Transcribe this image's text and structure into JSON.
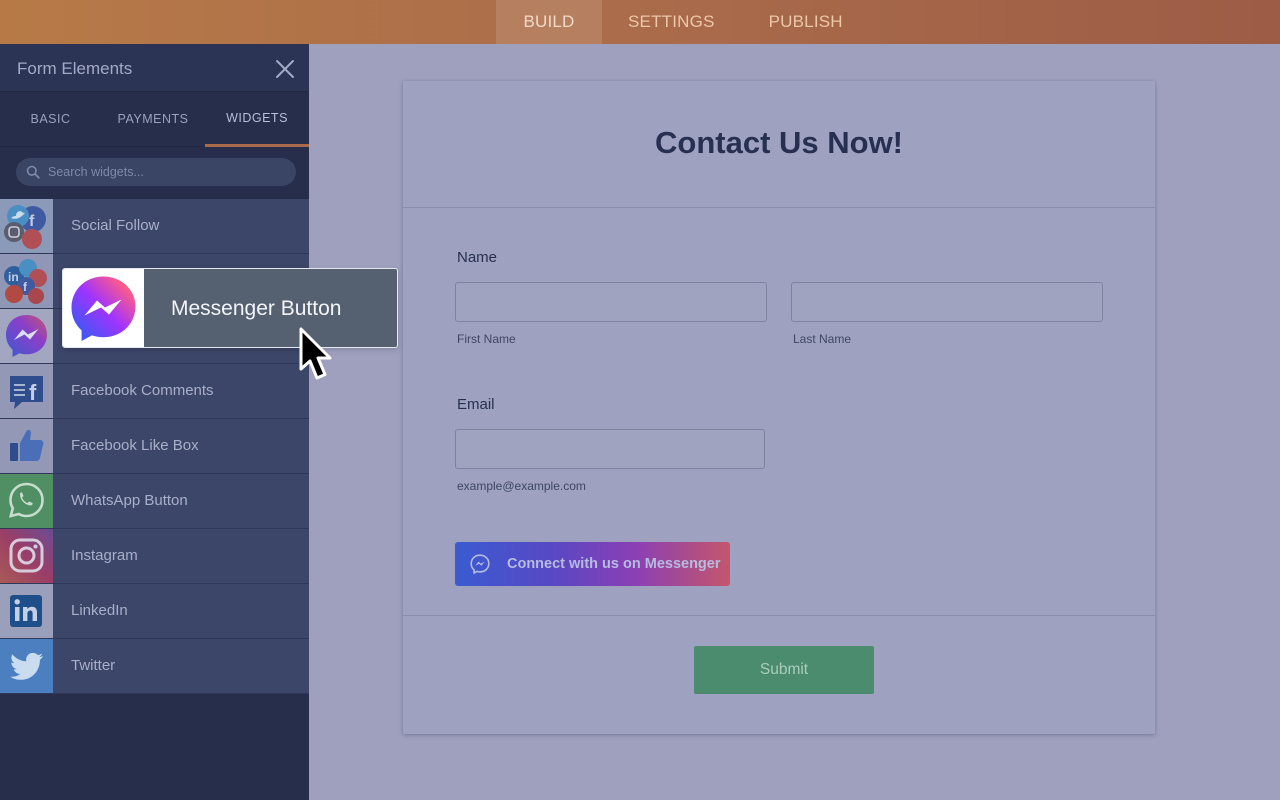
{
  "topbar": {
    "tabs": [
      {
        "label": "BUILD",
        "active": true
      },
      {
        "label": "SETTINGS",
        "active": false
      },
      {
        "label": "PUBLISH",
        "active": false
      }
    ]
  },
  "sidebar": {
    "title": "Form Elements",
    "close_icon": "close-icon",
    "tabs": [
      {
        "label": "BASIC",
        "active": false
      },
      {
        "label": "PAYMENTS",
        "active": false
      },
      {
        "label": "WIDGETS",
        "active": true
      }
    ],
    "search": {
      "placeholder": "Search widgets..."
    },
    "widgets": [
      {
        "label": "Social Follow",
        "icon": "social-follow-icon"
      },
      {
        "label": "",
        "icon": "social-share-icon"
      },
      {
        "label": "",
        "icon": "messenger-icon"
      },
      {
        "label": "Facebook Comments",
        "icon": "facebook-comments-icon"
      },
      {
        "label": "Facebook Like Box",
        "icon": "facebook-like-icon"
      },
      {
        "label": "WhatsApp Button",
        "icon": "whatsapp-icon"
      },
      {
        "label": "Instagram",
        "icon": "instagram-icon"
      },
      {
        "label": "LinkedIn",
        "icon": "linkedin-icon"
      },
      {
        "label": "Twitter",
        "icon": "twitter-icon"
      }
    ]
  },
  "drag_ghost": {
    "label": "Messenger Button",
    "icon": "messenger-icon"
  },
  "form": {
    "title": "Contact Us Now!",
    "name_label": "Name",
    "first_name_sublabel": "First Name",
    "last_name_sublabel": "Last Name",
    "first_name_value": "",
    "last_name_value": "",
    "email_label": "Email",
    "email_value": "",
    "email_sublabel": "example@example.com",
    "messenger_button_label": "Connect with us on Messenger",
    "submit_label": "Submit"
  },
  "colors": {
    "topbar": "#a86a4a",
    "sidebar": "#262e4c",
    "widget_row": "#3c4669",
    "form_background": "#9ea1bf",
    "submit": "#4b8c6e",
    "active_tab_underline": "#a86a4a"
  }
}
